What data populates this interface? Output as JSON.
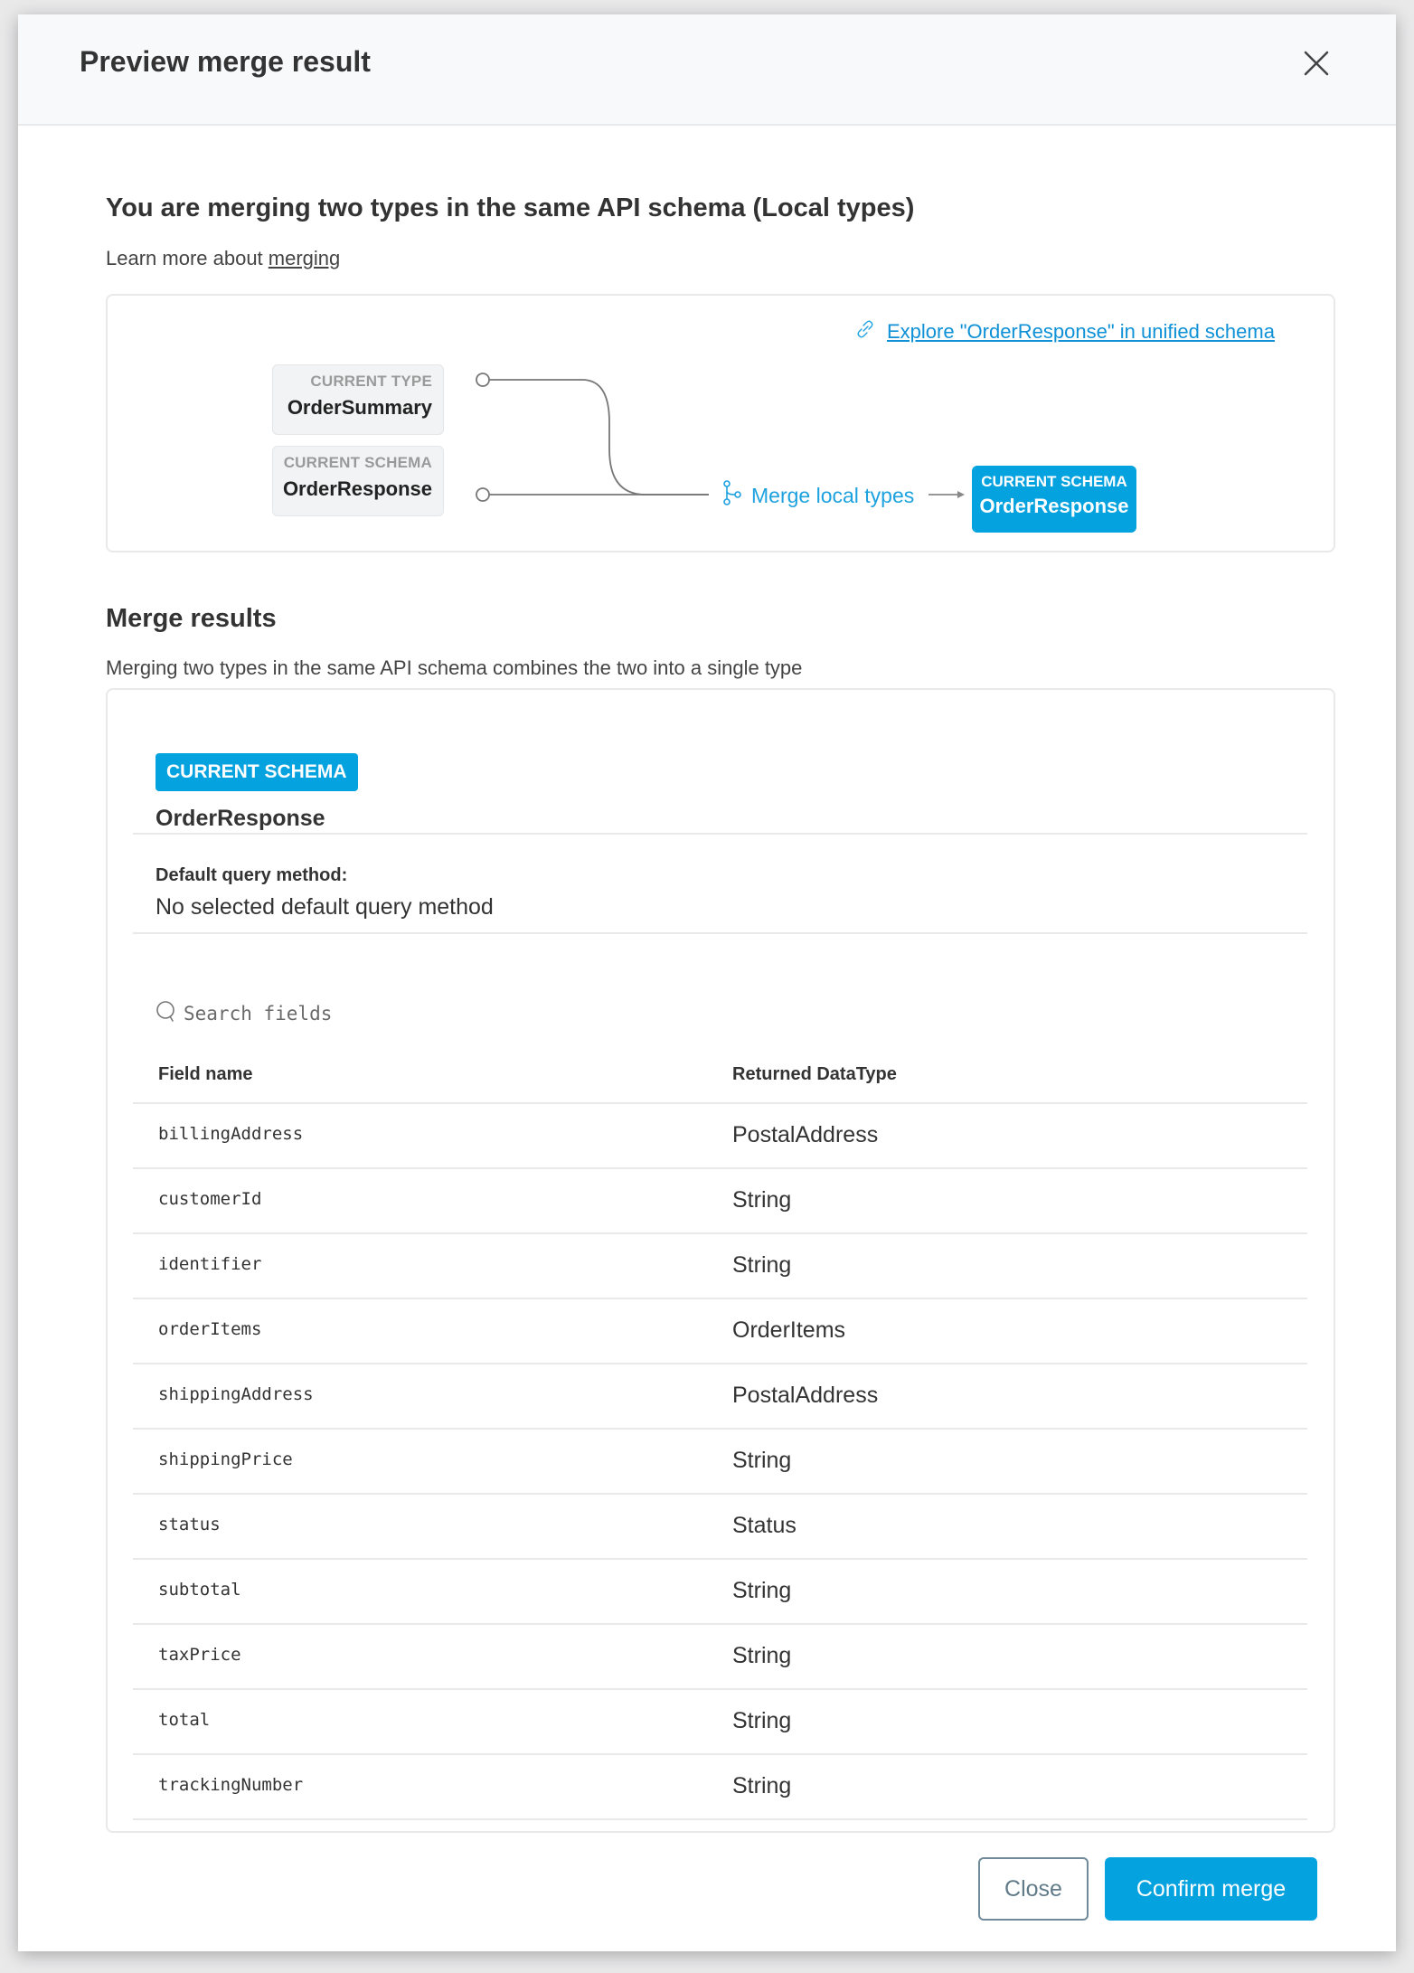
{
  "dialog": {
    "title": "Preview merge result",
    "close_icon": "close-icon"
  },
  "intro": {
    "heading": "You are merging two types in the same API schema (Local types)",
    "learn_prefix": "Learn more about ",
    "learn_link": "merging"
  },
  "diagram": {
    "explore_icon": "link-icon",
    "explore_link": "Explore \"OrderResponse\" in unified schema",
    "sources": [
      {
        "label": "CURRENT TYPE",
        "name": "OrderSummary"
      },
      {
        "label": "CURRENT SCHEMA",
        "name": "OrderResponse"
      }
    ],
    "merge_icon": "merge-branch-icon",
    "merge_label": "Merge local types",
    "result": {
      "label": "CURRENT SCHEMA",
      "name": "OrderResponse"
    },
    "accent_color": "#05a2e0"
  },
  "results": {
    "heading": "Merge results",
    "description": "Merging two types in the same API schema combines the two into a single type",
    "badge": "CURRENT SCHEMA",
    "type_name": "OrderResponse",
    "default_query_label": "Default query method:",
    "default_query_value": "No selected default query method",
    "search_placeholder": "Search fields",
    "search_value": "",
    "columns": [
      "Field name",
      "Returned DataType"
    ],
    "fields": [
      {
        "name": "billingAddress",
        "type": "PostalAddress"
      },
      {
        "name": "customerId",
        "type": "String"
      },
      {
        "name": "identifier",
        "type": "String"
      },
      {
        "name": "orderItems",
        "type": "OrderItems"
      },
      {
        "name": "shippingAddress",
        "type": "PostalAddress"
      },
      {
        "name": "shippingPrice",
        "type": "String"
      },
      {
        "name": "status",
        "type": "Status"
      },
      {
        "name": "subtotal",
        "type": "String"
      },
      {
        "name": "taxPrice",
        "type": "String"
      },
      {
        "name": "total",
        "type": "String"
      },
      {
        "name": "trackingNumber",
        "type": "String"
      }
    ]
  },
  "footer": {
    "close_label": "Close",
    "confirm_label": "Confirm merge"
  }
}
